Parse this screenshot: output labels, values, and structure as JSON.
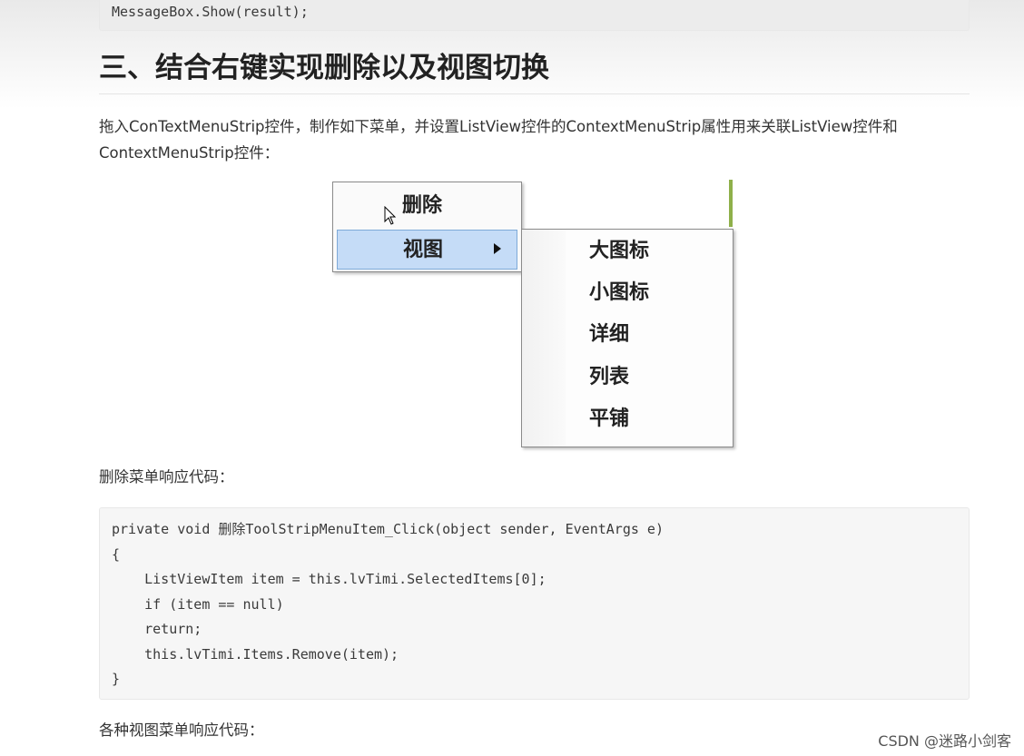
{
  "code_top": {
    "line": "MessageBox.Show(result);"
  },
  "heading": "三、结合右键实现删除以及视图切换",
  "intro": "拖入ConTextMenuStrip控件，制作如下菜单，并设置ListView控件的ContextMenuStrip属性用来关联ListView控件和ContextMenuStrip控件：",
  "context_menu": {
    "items": [
      {
        "label": "删除"
      },
      {
        "label": "视图"
      }
    ],
    "submenu": [
      {
        "label": "大图标"
      },
      {
        "label": "小图标"
      },
      {
        "label": "详细"
      },
      {
        "label": "列表"
      },
      {
        "label": "平铺"
      }
    ],
    "highlight_color": "#c5dcf7"
  },
  "delete_caption": "删除菜单响应代码：",
  "code_main": {
    "lines": [
      "private void 删除ToolStripMenuItem_Click(object sender, EventArgs e)",
      "{",
      "    ListViewItem item = this.lvTimi.SelectedItems[0];",
      "    if (item == null)",
      "    return;",
      "    this.lvTimi.Items.Remove(item);",
      "}"
    ]
  },
  "view_caption": "各种视图菜单响应代码：",
  "watermark": "CSDN @迷路小剑客"
}
